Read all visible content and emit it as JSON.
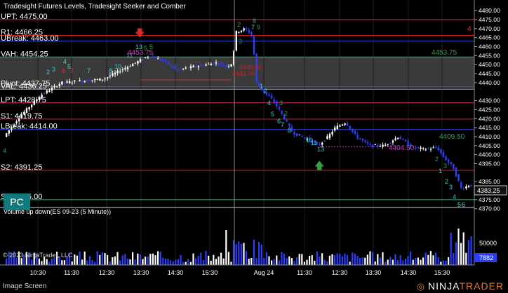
{
  "chart": {
    "title": "Tradesight Futures Levels, Tradesight Seeker and Comber",
    "copyright": "© 2023 NinjaTrader, LLC",
    "price_range": [
      4366,
      4482
    ],
    "volume_title": "Volume up down(ES 09-23 (5 Minute))",
    "volume_scale_label": "50000",
    "volume_current": "7882",
    "current_price": "4383.25",
    "price_ticks": [
      "4480.00",
      "4475.00",
      "4470.00",
      "4465.00",
      "4460.00",
      "4455.00",
      "4450.00",
      "4445.00",
      "4440.00",
      "4430.00",
      "4425.00",
      "4420.00",
      "4415.00",
      "4410.00",
      "4405.00",
      "4400.00",
      "4395.00",
      "4385.00",
      "4380.00",
      "4375.00",
      "4370.00"
    ],
    "time_labels": [
      "10:30",
      "11:30",
      "12:30",
      "13:30",
      "14:30",
      "15:30",
      "Aug 24",
      "11:30",
      "12:30",
      "13:30",
      "14:30",
      "15:30"
    ],
    "levels": [
      {
        "label": "UPT: 4475.00",
        "price": 4475.0,
        "color": "#d0306a"
      },
      {
        "label": "R1: 4466.25",
        "price": 4466.25,
        "color": "#d01e1e"
      },
      {
        "label": "UBreak: 4463.00",
        "price": 4463.0,
        "color": "#2b4de0"
      },
      {
        "label": "VAH: 4454.25",
        "price": 4454.25,
        "color": "#2fb08a"
      },
      {
        "label": "Pivot: 4437.75",
        "price": 4437.75,
        "color": "#2b4de0"
      },
      {
        "label": "VAL: 4436.25",
        "price": 4436.25,
        "color": "#2fb08a"
      },
      {
        "label": "LPT: 4428.75",
        "price": 4428.75,
        "color": "#d0306a"
      },
      {
        "label": "S1: 4419.75",
        "price": 4419.75,
        "color": "#d01e1e"
      },
      {
        "label": "LBreak: 4414.00",
        "price": 4414.0,
        "color": "#2b4de0"
      },
      {
        "label": "S2: 4391.25",
        "price": 4391.25,
        "color": "#d01e1e"
      },
      {
        "label": "S3: 4375.00",
        "price": 4375.0,
        "color": "#2fb08a"
      }
    ],
    "annotations": [
      {
        "text": "4453.75",
        "color": "#2fa045"
      },
      {
        "text": "4409.50",
        "color": "#2fa045"
      },
      {
        "text": "4404.50",
        "color": "#d03ad0"
      },
      {
        "text": "4453.75",
        "color": "#d03ad0"
      },
      {
        "text": "4446.50",
        "color": "#d01e1e"
      },
      {
        "text": "4442.00",
        "color": "#d01e1e"
      },
      {
        "text": "4",
        "color": "#e03030"
      }
    ]
  },
  "badge": {
    "label": "PC"
  },
  "footer": {
    "label": "Image Screen",
    "logo_main": "NINJA",
    "logo_accent": "TRADER",
    "logo_mark": "◎"
  },
  "colors": {
    "background": "#000000",
    "up_candle": "#ffffff",
    "down_candle": "#2b3dff",
    "value_area": "#6a6a6a"
  }
}
